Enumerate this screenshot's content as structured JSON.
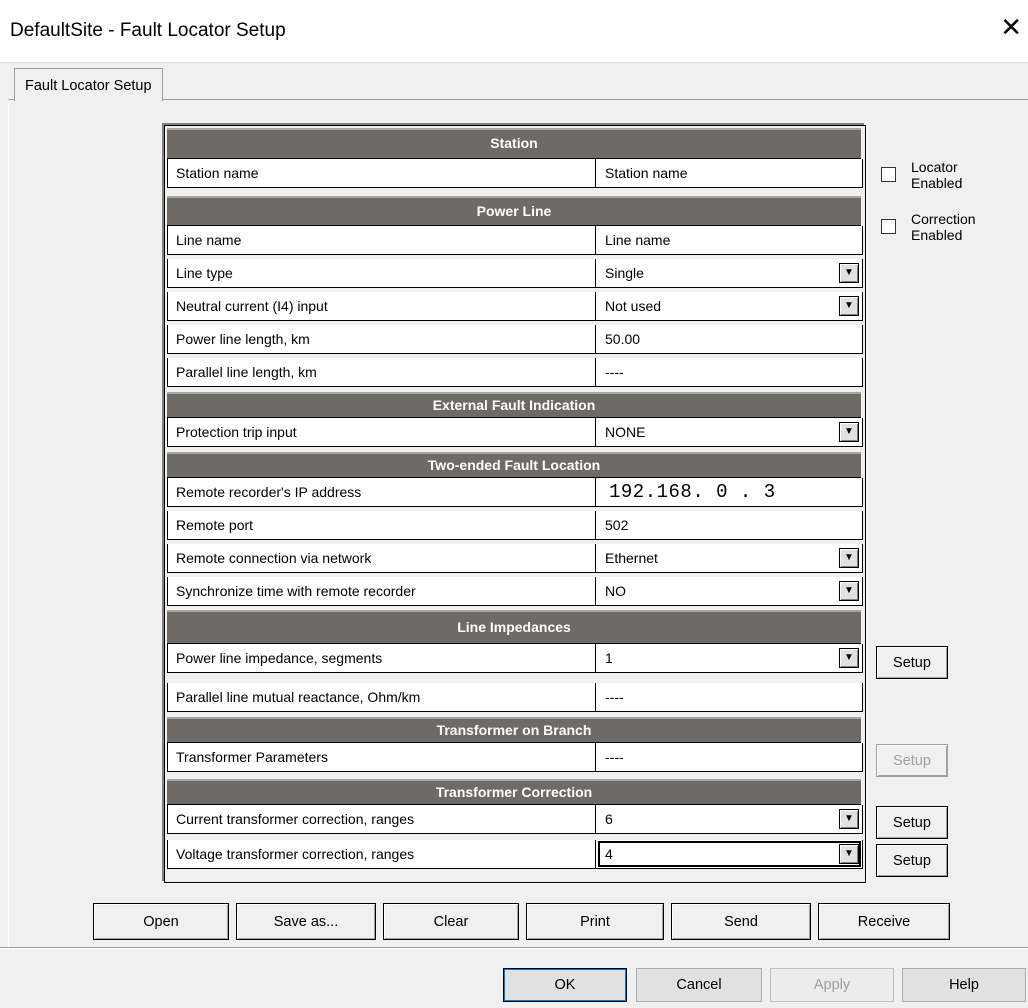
{
  "window": {
    "title": "DefaultSite - Fault Locator Setup",
    "close_glyph": "✕"
  },
  "tabs": [
    {
      "label": "Fault Locator Setup"
    }
  ],
  "sections": {
    "station": "Station",
    "power_line": "Power Line",
    "external_fault": "External Fault Indication",
    "two_ended": "Two-ended Fault Location",
    "impedances": "Line Impedances",
    "transformer_branch": "Transformer on Branch",
    "transformer_correction": "Transformer Correction"
  },
  "fields": {
    "station_name": {
      "label": "Station name",
      "value": "Station name"
    },
    "line_name": {
      "label": "Line name",
      "value": "Line name"
    },
    "line_type": {
      "label": "Line type",
      "value": "Single"
    },
    "neutral_input": {
      "label": "Neutral current (I4) input",
      "value": "Not used"
    },
    "line_length": {
      "label": "Power line length, km",
      "value": "50.00"
    },
    "parallel_length": {
      "label": "Parallel line length, km",
      "value": "----"
    },
    "protection_trip": {
      "label": "Protection trip input",
      "value": "NONE"
    },
    "remote_ip": {
      "label": "Remote recorder's IP address",
      "value": "192.168. 0 . 3"
    },
    "remote_port": {
      "label": "Remote port",
      "value": "502"
    },
    "remote_connection": {
      "label": "Remote connection via network",
      "value": "Ethernet"
    },
    "sync_time": {
      "label": "Synchronize time with remote recorder",
      "value": "NO"
    },
    "impedance_segments": {
      "label": "Power line impedance, segments",
      "value": "1"
    },
    "mutual_reactance": {
      "label": "Parallel line mutual reactance, Ohm/km",
      "value": "----"
    },
    "transformer_params": {
      "label": "Transformer Parameters",
      "value": "----"
    },
    "ct_correction": {
      "label": "Current transformer correction, ranges",
      "value": "6"
    },
    "vt_correction": {
      "label": "Voltage transformer correction, ranges",
      "value": "4"
    }
  },
  "dropdown_glyph": "▼",
  "checkboxes": {
    "locator_enabled": {
      "label_1": "Locator",
      "label_2": "Enabled",
      "checked": false
    },
    "correction_enabled": {
      "label_1": "Correction",
      "label_2": "Enabled",
      "checked": false
    }
  },
  "setup_label": "Setup",
  "file_buttons": {
    "open": "Open",
    "save_as": "Save as...",
    "clear": "Clear",
    "print": "Print",
    "send": "Send",
    "receive": "Receive"
  },
  "dialog_buttons": {
    "ok": "OK",
    "cancel": "Cancel",
    "apply": "Apply",
    "help": "Help"
  },
  "colors": {
    "section_header": "#6e6a66",
    "dialog_bg": "#f0f0f0",
    "focus_accent": "#0078d7"
  }
}
